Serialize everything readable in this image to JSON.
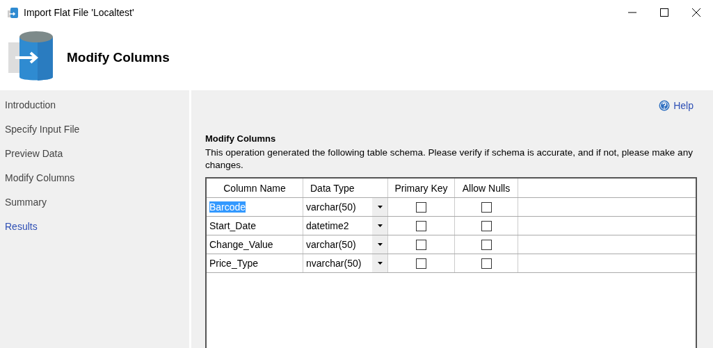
{
  "window": {
    "title": "Import Flat File 'Localtest'"
  },
  "header": {
    "title": "Modify Columns"
  },
  "sidebar": {
    "items": [
      {
        "label": "Introduction",
        "selected": false
      },
      {
        "label": "Specify Input File",
        "selected": false
      },
      {
        "label": "Preview Data",
        "selected": false
      },
      {
        "label": "Modify Columns",
        "selected": false
      },
      {
        "label": "Summary",
        "selected": false
      },
      {
        "label": "Results",
        "selected": true
      }
    ]
  },
  "help": {
    "label": "Help"
  },
  "section": {
    "title": "Modify Columns",
    "description": "This operation generated the following table schema. Please verify if schema is accurate, and if not, please make any changes."
  },
  "table": {
    "columns": [
      "Column Name",
      "Data Type",
      "Primary Key",
      "Allow Nulls"
    ],
    "rows": [
      {
        "name": "Barcode",
        "type": "varchar(50)",
        "primary_key": false,
        "allow_nulls": false,
        "selected": true
      },
      {
        "name": "Start_Date",
        "type": "datetime2",
        "primary_key": false,
        "allow_nulls": false,
        "selected": false
      },
      {
        "name": "Change_Value",
        "type": "varchar(50)",
        "primary_key": false,
        "allow_nulls": false,
        "selected": false
      },
      {
        "name": "Price_Type",
        "type": "nvarchar(50)",
        "primary_key": false,
        "allow_nulls": false,
        "selected": false
      }
    ]
  }
}
